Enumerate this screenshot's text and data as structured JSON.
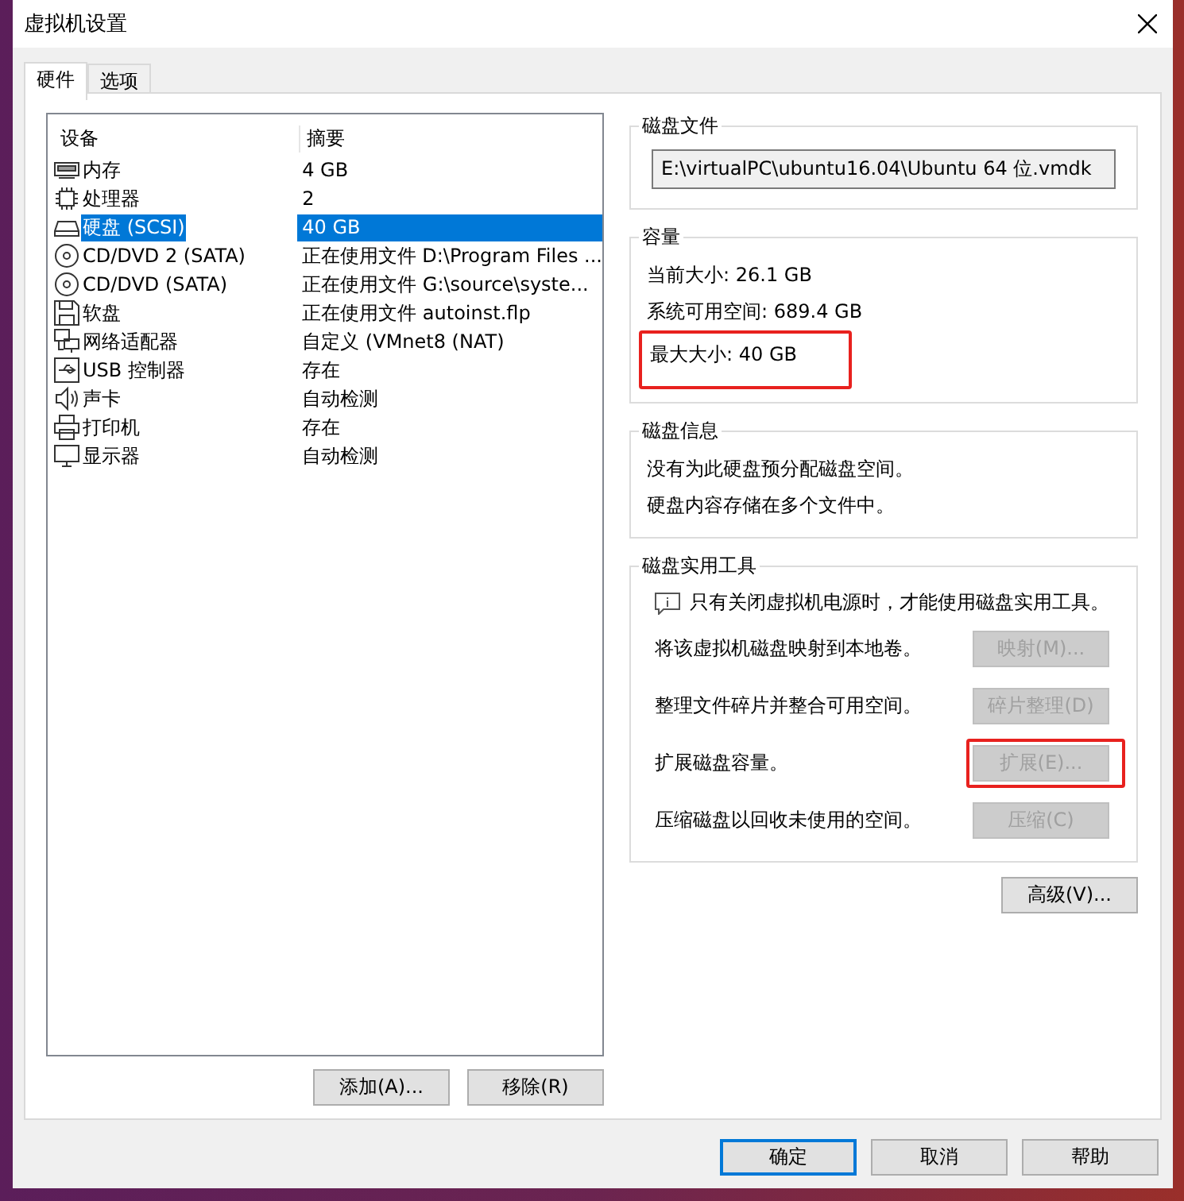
{
  "window": {
    "title": "虚拟机设置"
  },
  "tabs": [
    {
      "label": "硬件",
      "selected": true
    },
    {
      "label": "选项",
      "selected": false
    }
  ],
  "device_table": {
    "columns": [
      "设备",
      "摘要"
    ],
    "rows": [
      {
        "kind": "memory",
        "device": "内存",
        "summary": "4 GB",
        "selected": false
      },
      {
        "kind": "cpu",
        "device": "处理器",
        "summary": "2",
        "selected": false
      },
      {
        "kind": "disk",
        "device": "硬盘 (SCSI)",
        "summary": "40 GB",
        "selected": true
      },
      {
        "kind": "cdrom",
        "device": "CD/DVD 2 (SATA)",
        "summary": "正在使用文件 D:\\Program Files ...",
        "selected": false
      },
      {
        "kind": "cdrom",
        "device": "CD/DVD (SATA)",
        "summary": "正在使用文件 G:\\source\\syste...",
        "selected": false
      },
      {
        "kind": "floppy",
        "device": "软盘",
        "summary": "正在使用文件 autoinst.flp",
        "selected": false
      },
      {
        "kind": "network",
        "device": "网络适配器",
        "summary": "自定义 (VMnet8 (NAT)",
        "selected": false
      },
      {
        "kind": "usb",
        "device": "USB 控制器",
        "summary": "存在",
        "selected": false
      },
      {
        "kind": "sound",
        "device": "声卡",
        "summary": "自动检测",
        "selected": false
      },
      {
        "kind": "printer",
        "device": "打印机",
        "summary": "存在",
        "selected": false
      },
      {
        "kind": "display",
        "device": "显示器",
        "summary": "自动检测",
        "selected": false
      }
    ],
    "buttons": [
      "添加(A)...",
      "移除(R)"
    ]
  },
  "disk_file": {
    "title": "磁盘文件",
    "value": "E:\\virtualPC\\ubuntu16.04\\Ubuntu 64 位.vmdk"
  },
  "capacity": {
    "title": "容量",
    "items": [
      {
        "text": "当前大小: 26.1 GB",
        "highlighted": false
      },
      {
        "text": "系统可用空间: 689.4 GB",
        "highlighted": false
      },
      {
        "text": "最大大小: 40 GB",
        "highlighted": true
      }
    ]
  },
  "disk_info": {
    "title": "磁盘信息",
    "lines": [
      "没有为此硬盘预分配磁盘空间。",
      "硬盘内容存储在多个文件中。"
    ]
  },
  "disk_utilities": {
    "title": "磁盘实用工具",
    "note": "只有关闭虚拟机电源时，才能使用磁盘实用工具。",
    "rows": [
      {
        "label": "将该虚拟机磁盘映射到本地卷。",
        "button": "映射(M)...",
        "disabled": true,
        "highlighted": false
      },
      {
        "label": "整理文件碎片并整合可用空间。",
        "button": "碎片整理(D)",
        "disabled": true,
        "highlighted": false
      },
      {
        "label": "扩展磁盘容量。",
        "button": "扩展(E)...",
        "disabled": true,
        "highlighted": true
      },
      {
        "label": "压缩磁盘以回收未使用的空间。",
        "button": "压缩(C)",
        "disabled": true,
        "highlighted": false
      }
    ]
  },
  "advanced_button": "高级(V)...",
  "footer_buttons": [
    {
      "label": "确定",
      "focused": true
    },
    {
      "label": "取消",
      "focused": false
    },
    {
      "label": "帮助",
      "focused": false
    }
  ]
}
